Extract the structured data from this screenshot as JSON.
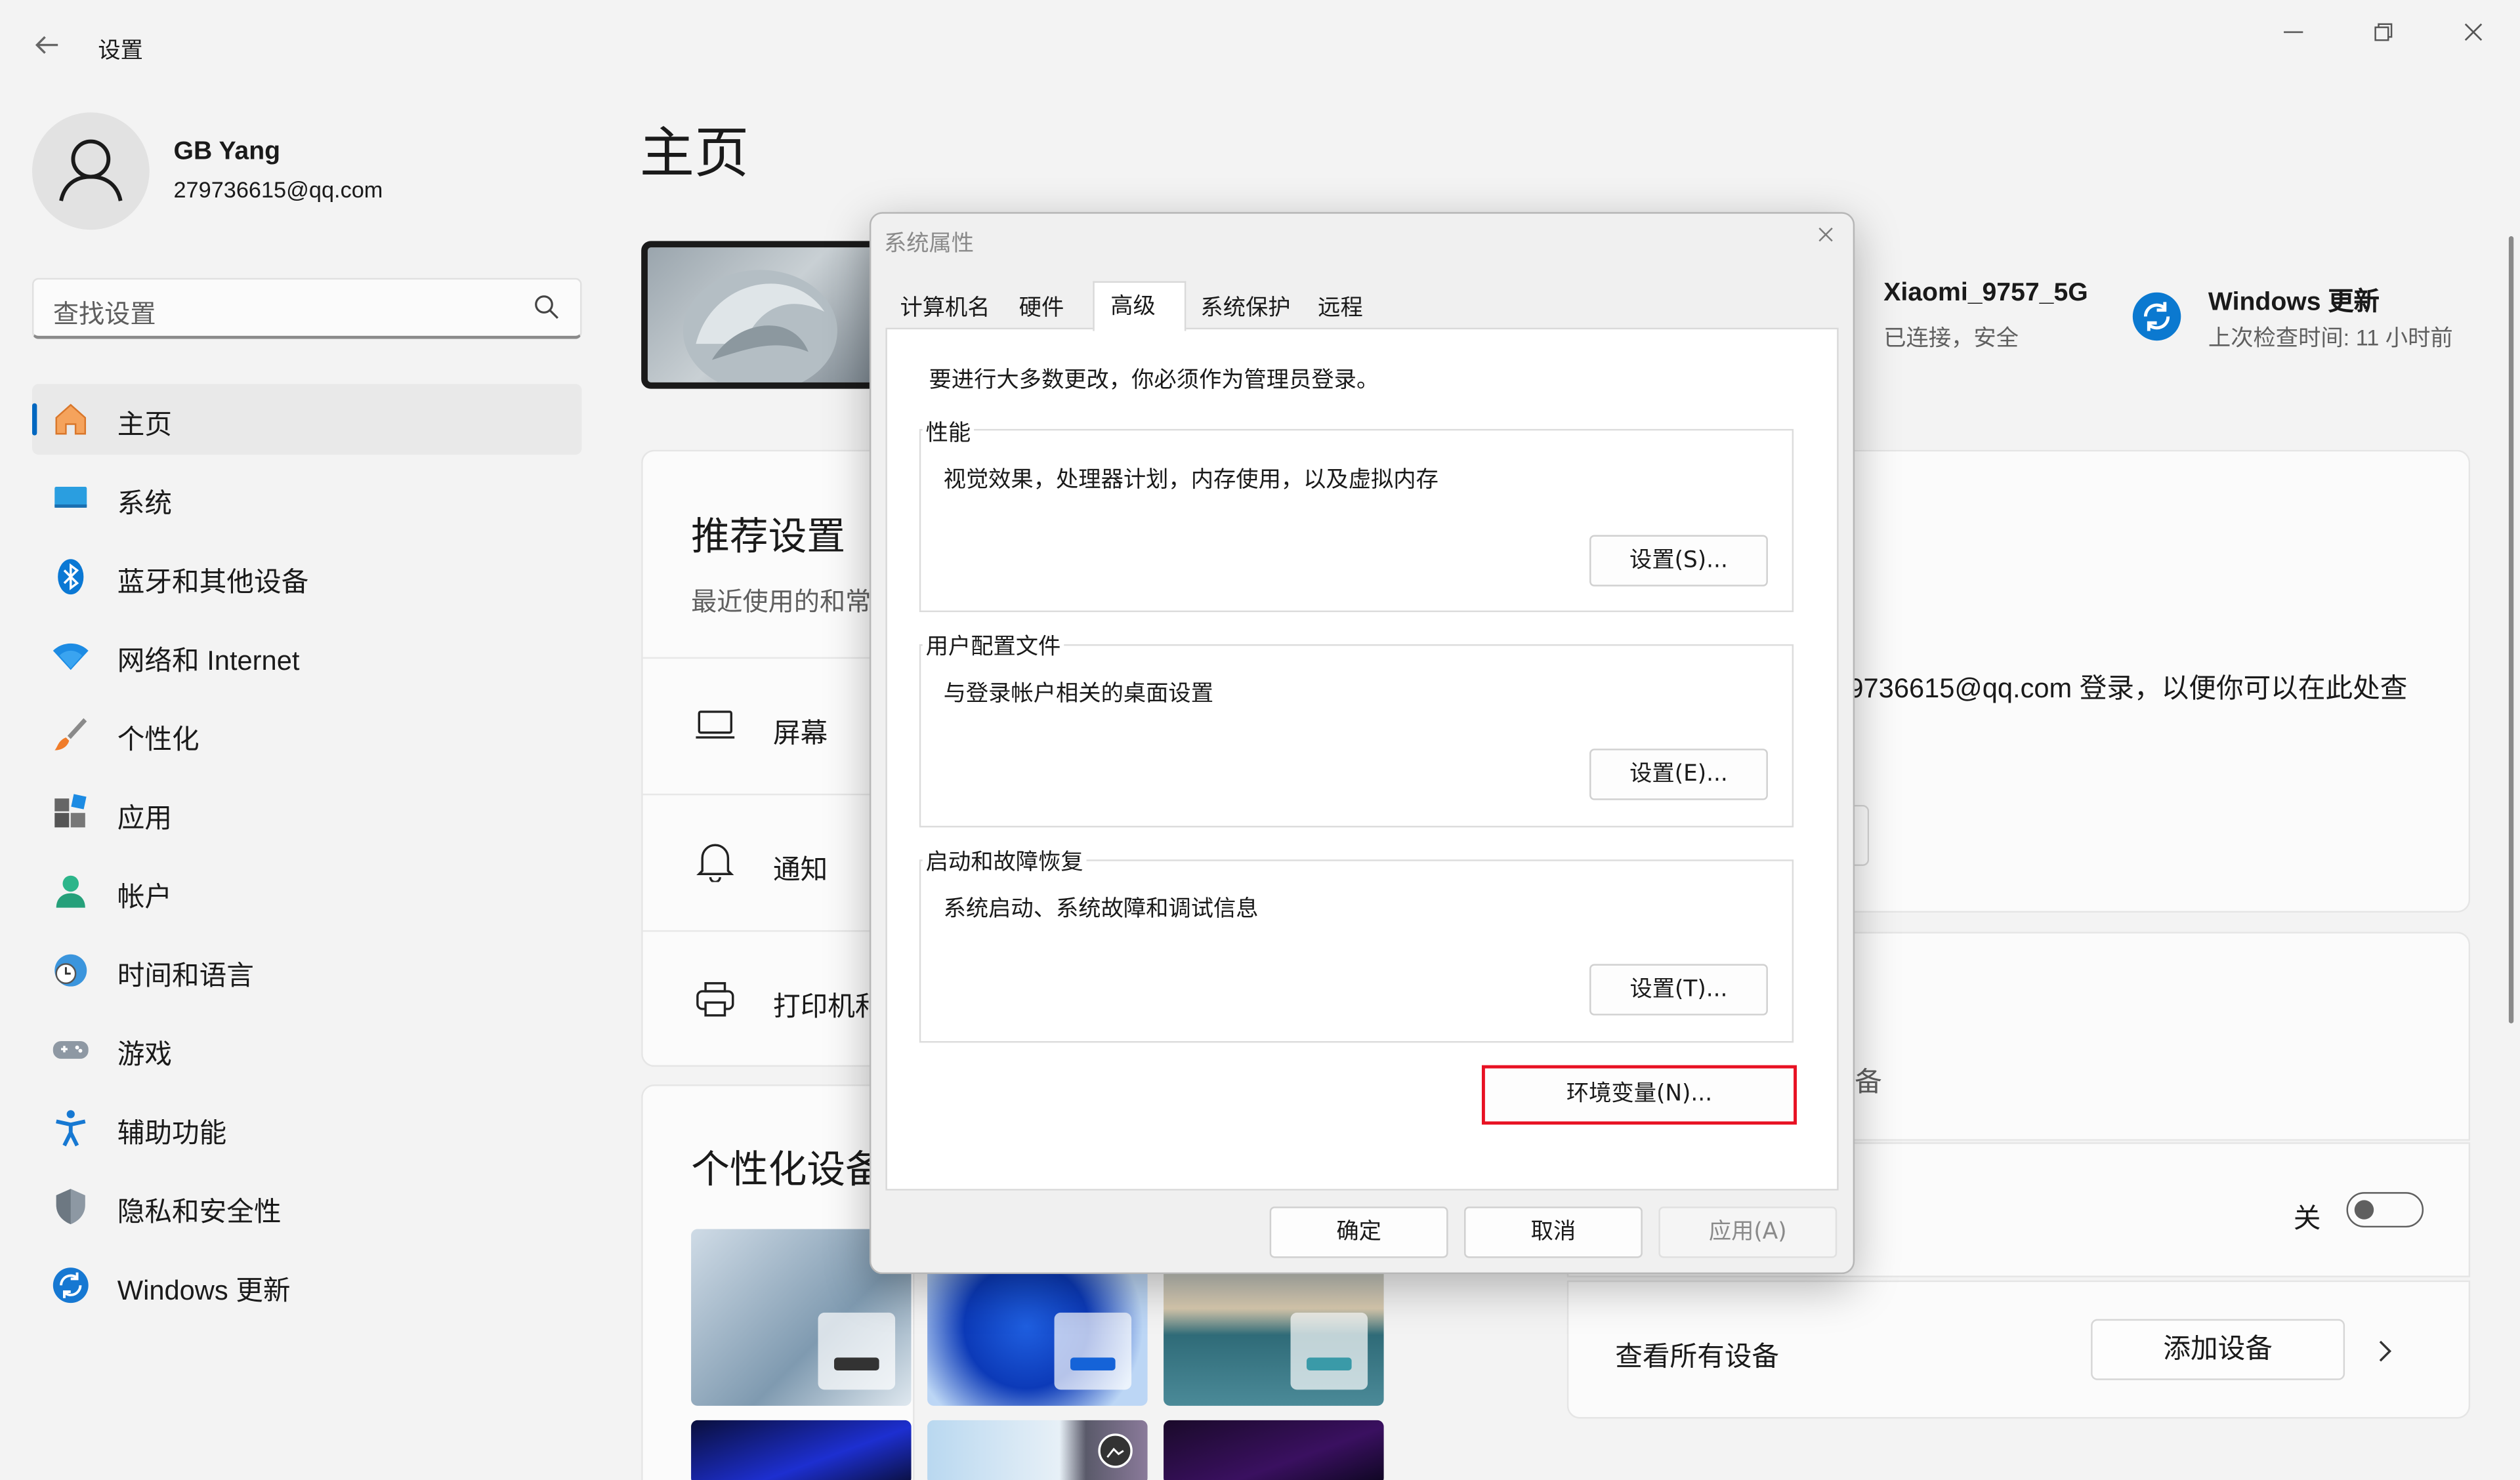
{
  "window": {
    "title": "设置",
    "back_icon": "arrow-left-icon",
    "controls": [
      "minimize-icon",
      "restore-icon",
      "close-icon"
    ]
  },
  "profile": {
    "name": "GB Yang",
    "email": "279736615@qq.com",
    "avatar_icon": "person-icon"
  },
  "search": {
    "placeholder": "查找设置",
    "icon": "search-icon"
  },
  "sidebar": {
    "selected_index": 0,
    "items": [
      {
        "label": "主页",
        "icon": "home-icon"
      },
      {
        "label": "系统",
        "icon": "monitor-icon"
      },
      {
        "label": "蓝牙和其他设备",
        "icon": "bluetooth-icon"
      },
      {
        "label": "网络和 Internet",
        "icon": "wifi-icon"
      },
      {
        "label": "个性化",
        "icon": "brush-icon"
      },
      {
        "label": "应用",
        "icon": "apps-icon"
      },
      {
        "label": "帐户",
        "icon": "account-icon"
      },
      {
        "label": "时间和语言",
        "icon": "globe-clock-icon"
      },
      {
        "label": "游戏",
        "icon": "gamepad-icon"
      },
      {
        "label": "辅助功能",
        "icon": "accessibility-icon"
      },
      {
        "label": "隐私和安全性",
        "icon": "shield-icon"
      },
      {
        "label": "Windows 更新",
        "icon": "windows-update-icon"
      }
    ]
  },
  "main": {
    "title": "主页",
    "network_tile": {
      "title": "Xiaomi_9757_5G",
      "status": "已连接，安全"
    },
    "update_tile": {
      "title": "Windows 更新",
      "status": "上次检查时间: 11 小时前"
    },
    "recommended": {
      "heading": "推荐设置",
      "subtitle": "最近使用的和常",
      "rows": [
        {
          "label": "屏幕",
          "icon": "laptop-icon"
        },
        {
          "label": "通知",
          "icon": "bell-icon"
        },
        {
          "label": "打印机和",
          "icon": "printer-icon"
        }
      ]
    },
    "account_card": {
      "text": "9736615@qq.com 登录，以便你可以在此处查"
    },
    "devices_card": {
      "partial_text": "备",
      "toggle_label": "关",
      "see_all": "查看所有设备",
      "add_button": "添加设备"
    },
    "personalize": {
      "heading": "个性化设备"
    }
  },
  "dialog": {
    "title": "系统属性",
    "tabs": [
      "计算机名",
      "硬件",
      "高级",
      "系统保护",
      "远程"
    ],
    "active_tab": "高级",
    "admin_note": "要进行大多数更改，你必须作为管理员登录。",
    "groups": [
      {
        "label": "性能",
        "desc": "视觉效果，处理器计划，内存使用，以及虚拟内存",
        "button": "设置(S)..."
      },
      {
        "label": "用户配置文件",
        "desc": "与登录帐户相关的桌面设置",
        "button": "设置(E)..."
      },
      {
        "label": "启动和故障恢复",
        "desc": "系统启动、系统故障和调试信息",
        "button": "设置(T)..."
      }
    ],
    "env_button": "环境变量(N)...",
    "ok_button": "确定",
    "cancel_button": "取消",
    "apply_button": "应用(A)"
  }
}
